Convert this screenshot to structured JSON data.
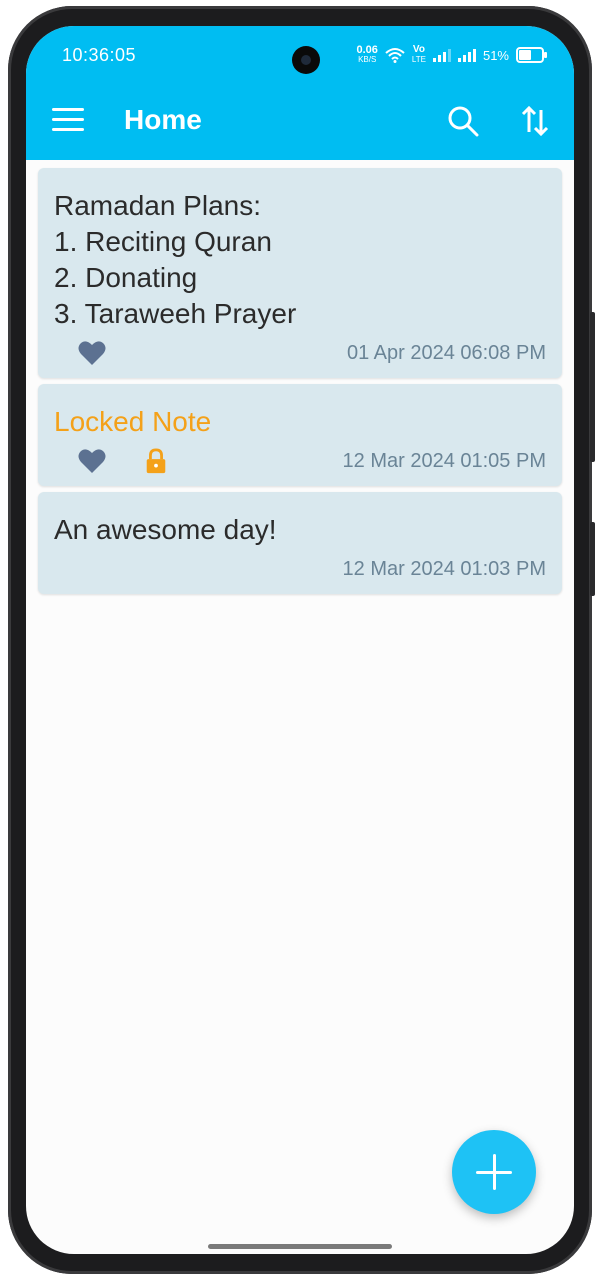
{
  "status": {
    "time": "10:36:05",
    "net_speed_value": "0.06",
    "net_speed_unit": "KB/S",
    "volte_top": "Vo",
    "volte_bottom": "LTE",
    "battery": "51%"
  },
  "appbar": {
    "title": "Home"
  },
  "notes": [
    {
      "text": "Ramadan Plans:\n1. Reciting Quran\n2. Donating\n3. Taraweeh Prayer",
      "date": "01 Apr 2024 06:08 PM",
      "favorite": true,
      "locked": false
    },
    {
      "text": "Locked Note",
      "date": "12 Mar 2024 01:05 PM",
      "favorite": true,
      "locked": true
    },
    {
      "text": "An awesome day!",
      "date": "12 Mar 2024 01:03 PM",
      "favorite": false,
      "locked": false
    }
  ],
  "colors": {
    "accent": "#00bdf2",
    "card": "#d9e8ee",
    "locked_text": "#f4a119",
    "heart": "#5c7191",
    "date": "#6a8496"
  },
  "icons": [
    "menu-icon",
    "search-icon",
    "sort-icon",
    "heart-icon",
    "lock-icon",
    "add-icon"
  ]
}
